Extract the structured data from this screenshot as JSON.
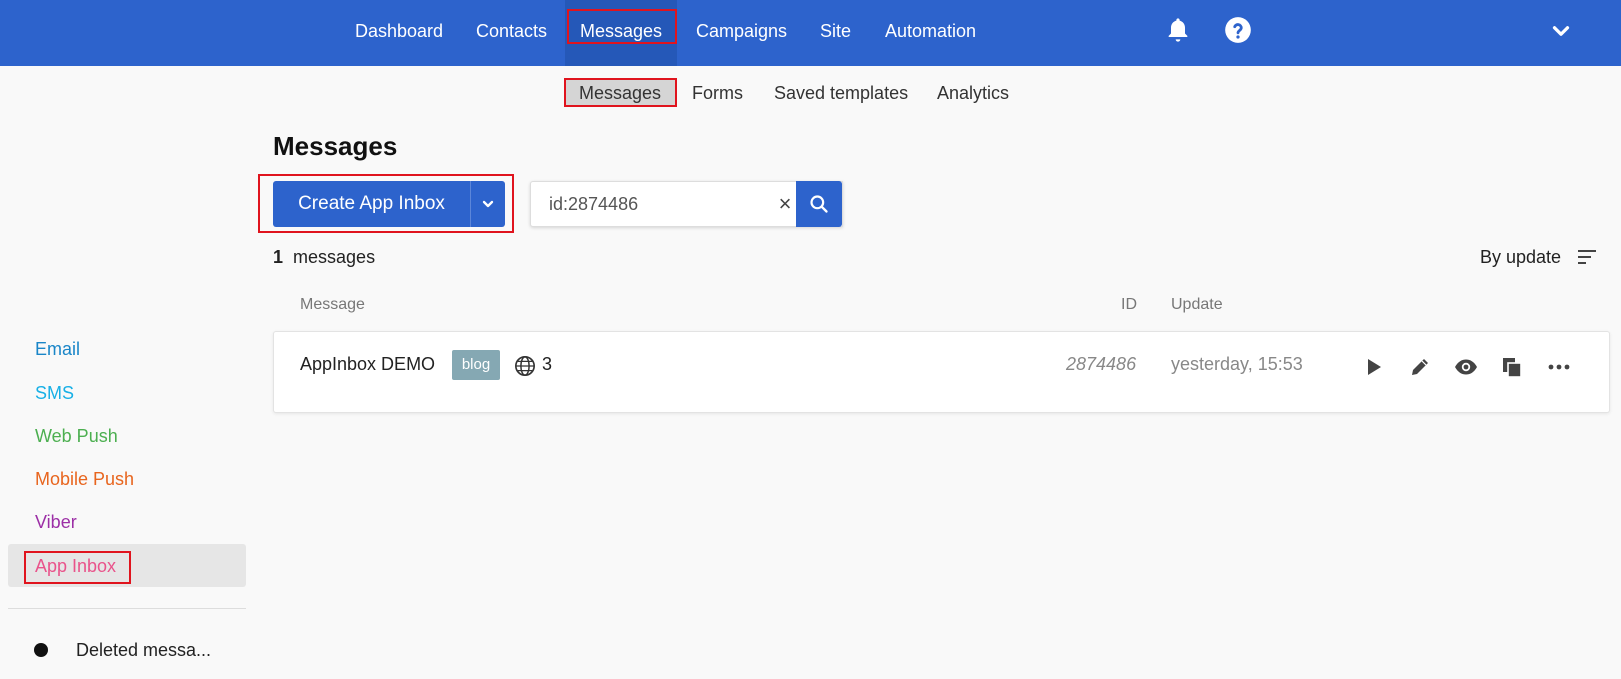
{
  "topnav": {
    "items": [
      "Dashboard",
      "Contacts",
      "Messages",
      "Campaigns",
      "Site",
      "Automation"
    ],
    "active": "Messages",
    "icons": [
      "bell-icon",
      "help-icon",
      "chevron-down-icon"
    ]
  },
  "subnav": {
    "items": [
      "Messages",
      "Forms",
      "Saved templates",
      "Analytics"
    ],
    "active": "Messages"
  },
  "sidebar": {
    "items": [
      {
        "label": "Email",
        "color": "#1a86c8"
      },
      {
        "label": "SMS",
        "color": "#18b0e6"
      },
      {
        "label": "Web Push",
        "color": "#4caf50"
      },
      {
        "label": "Mobile Push",
        "color": "#e8651e"
      },
      {
        "label": "Viber",
        "color": "#9c2fa6"
      },
      {
        "label": "App Inbox",
        "color": "#e9538b"
      }
    ],
    "active": "App Inbox",
    "deleted_label": "Deleted messa..."
  },
  "main": {
    "title": "Messages",
    "create_label": "Create App Inbox",
    "search_value": "id:2874486",
    "count_number": "1",
    "count_text": "messages",
    "sort_label": "By update",
    "columns": {
      "message": "Message",
      "id": "ID",
      "update": "Update"
    },
    "rows": [
      {
        "name": "AppInbox DEMO",
        "tag": "blog",
        "sites": "3",
        "id": "2874486",
        "updated": "yesterday, 15:53"
      }
    ]
  },
  "colors": {
    "brand": "#2d63cc",
    "highlight": "#e0141e"
  }
}
